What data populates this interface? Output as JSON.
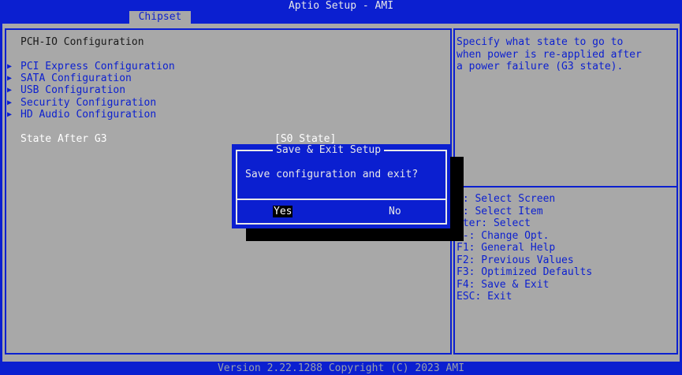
{
  "window": {
    "title": "Aptio Setup - AMI"
  },
  "tabs": [
    {
      "label": "Chipset"
    }
  ],
  "left": {
    "heading": "PCH-IO Configuration",
    "menu": [
      {
        "label": "PCI Express Configuration"
      },
      {
        "label": "SATA Configuration"
      },
      {
        "label": "USB Configuration"
      },
      {
        "label": "Security Configuration"
      },
      {
        "label": "HD Audio Configuration"
      }
    ],
    "setting": {
      "label": "State After G3",
      "value": "[S0 State]"
    }
  },
  "help": {
    "text": "Specify what state to go to\nwhen power is re-applied after\na power failure (G3 state)."
  },
  "keys": [
    "←: Select Screen",
    "↓: Select Item",
    "nter: Select",
    "/-: Change Opt.",
    "F1: General Help",
    "F2: Previous Values",
    "F3: Optimized Defaults",
    "F4: Save & Exit",
    "ESC: Exit"
  ],
  "dialog": {
    "title": "Save & Exit Setup",
    "message": "Save configuration and exit?",
    "yes_label": "Yes",
    "no_label": "No"
  },
  "footer": {
    "text": "Version 2.22.1288 Copyright (C) 2023 AMI"
  },
  "icons": {
    "submenu": "triangle-right-icon"
  },
  "colors": {
    "background": "#0b1fd0",
    "panel": "#a8a8a8",
    "selected": "#000000"
  }
}
